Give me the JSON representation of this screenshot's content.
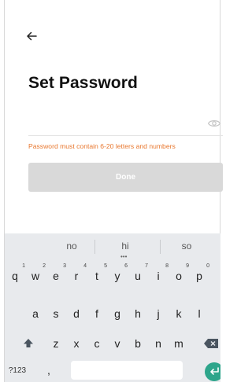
{
  "screen": {
    "title": "Set Password",
    "password": {
      "value": "",
      "placeholder": "",
      "hint": "Password must contain 6-20 letters and numbers"
    },
    "done_label": "Done"
  },
  "keyboard": {
    "suggestions": [
      "no",
      "hi",
      "so"
    ],
    "row1": [
      {
        "key": "q",
        "hint": "1"
      },
      {
        "key": "w",
        "hint": "2"
      },
      {
        "key": "e",
        "hint": "3"
      },
      {
        "key": "r",
        "hint": "4"
      },
      {
        "key": "t",
        "hint": "5"
      },
      {
        "key": "y",
        "hint": "6"
      },
      {
        "key": "u",
        "hint": "7"
      },
      {
        "key": "i",
        "hint": "8"
      },
      {
        "key": "o",
        "hint": "9"
      },
      {
        "key": "p",
        "hint": "0"
      }
    ],
    "row2": [
      "a",
      "s",
      "d",
      "f",
      "g",
      "h",
      "j",
      "k",
      "l"
    ],
    "row3": [
      "z",
      "x",
      "c",
      "v",
      "b",
      "n",
      "m"
    ],
    "symbols_label": "?123",
    "comma": ","
  },
  "colors": {
    "hint": "#e8772e",
    "done_disabled": "#d9d9d9",
    "keyboard_bg": "#e8eaed",
    "enter": "#2da58b"
  },
  "icons": {
    "back": "arrow-left-icon",
    "eye": "eye-icon",
    "shift": "shift-arrow-icon",
    "backspace": "backspace-icon",
    "enter": "enter-arrow-icon"
  }
}
